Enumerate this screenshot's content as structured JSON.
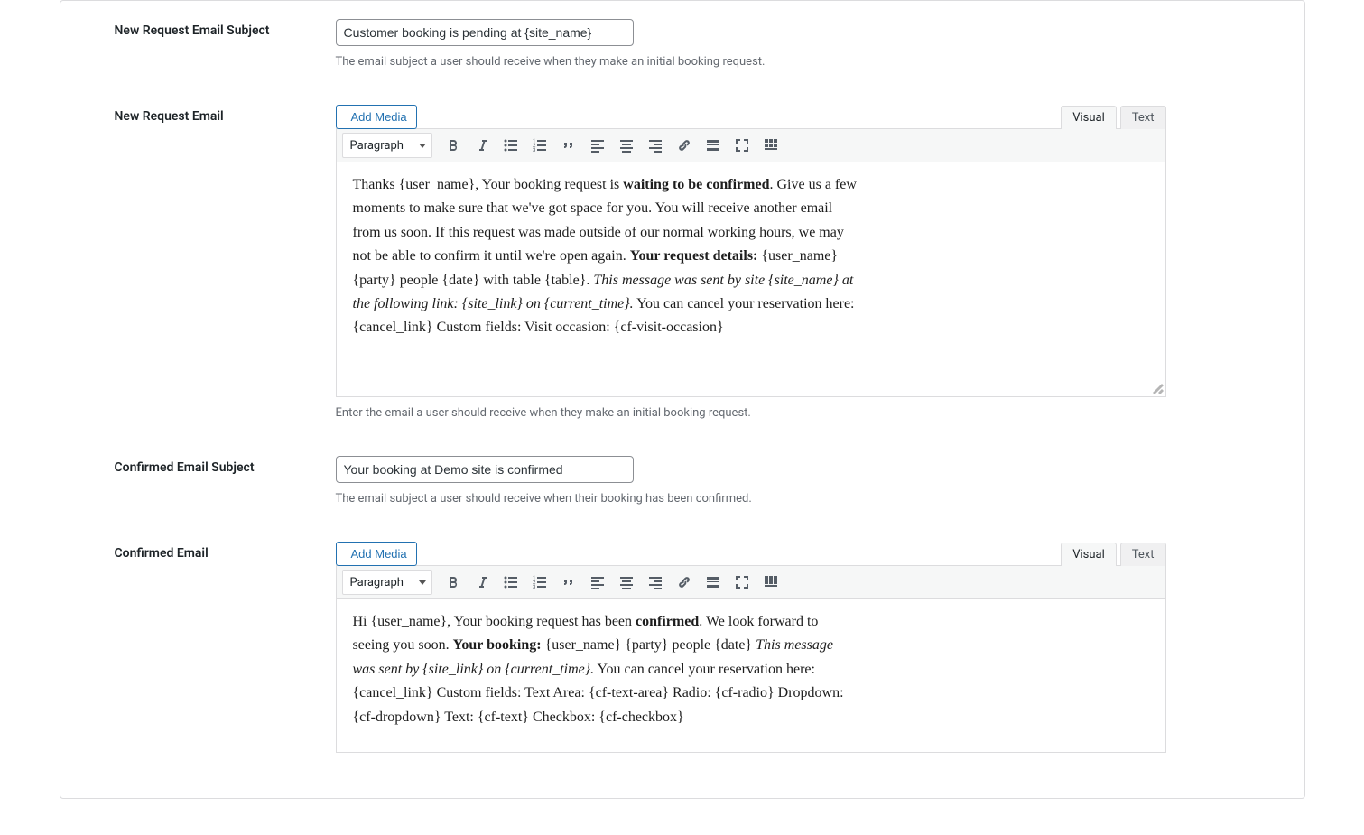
{
  "editor_common": {
    "add_media_label": "Add Media",
    "format_label": "Paragraph",
    "tab_visual": "Visual",
    "tab_text": "Text"
  },
  "fields": {
    "new_request_subject": {
      "label": "New Request Email Subject",
      "value": "Customer booking is pending at {site_name}",
      "description": "The email subject a user should receive when they make an initial booking request."
    },
    "new_request_email": {
      "label": "New Request Email",
      "description": "Enter the email a user should receive when they make an initial booking request.",
      "content_parts": {
        "p1_a": "Thanks {user_name}, Your booking request is ",
        "p1_strong": "waiting to be confirmed",
        "p1_b": ". Give us a few moments to make sure that we've got space for you. You will receive another email from us soon. If this request was made outside of our normal working hours, we may not be able to confirm it until we're open again. ",
        "p1_strong2": "Your request details:",
        "p1_c": " {user_name} {party} people {date} with table {table}. ",
        "p1_em": "This message was sent by site {site_name} at the following link: {site_link} on {current_time}.",
        "p1_d": " You can cancel your reservation here: {cancel_link} Custom fields: Visit occasion: {cf-visit-occasion}"
      }
    },
    "confirmed_subject": {
      "label": "Confirmed Email Subject",
      "value": "Your booking at Demo site is confirmed",
      "description": "The email subject a user should receive when their booking has been confirmed."
    },
    "confirmed_email": {
      "label": "Confirmed Email",
      "content_parts": {
        "p1_a": "Hi {user_name}, Your booking request has been ",
        "p1_strong": "confirmed",
        "p1_b": ". We look forward to seeing you soon. ",
        "p1_strong2": "Your booking:",
        "p1_c": " {user_name} {party} people {date}   ",
        "p1_em": "This message was sent by {site_link} on {current_time}.",
        "p1_d": " You can cancel your reservation here: {cancel_link} Custom fields: Text Area: {cf-text-area} Radio: {cf-radio} Dropdown: {cf-dropdown} Text: {cf-text} Checkbox: {cf-checkbox}"
      }
    }
  }
}
